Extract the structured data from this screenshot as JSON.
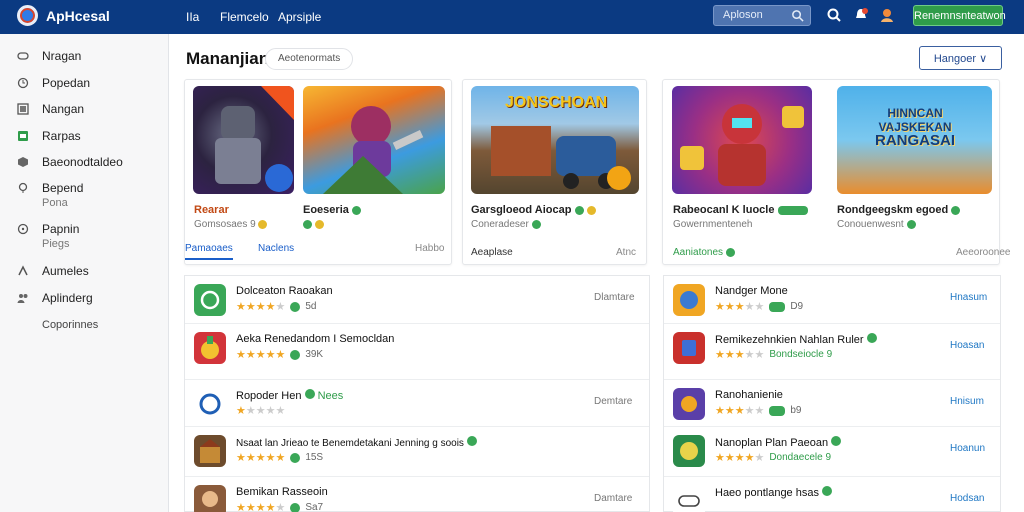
{
  "header": {
    "app_title": "ApHcesal",
    "nav": [
      "IIa",
      "Flemcelo",
      "Aprsiple"
    ],
    "search_placeholder": "Aploson",
    "cta_label": "Renemnsnteatwon"
  },
  "sidebar": {
    "items": [
      {
        "label": "Nragan",
        "icon": "gamepad-icon"
      },
      {
        "label": "Popedan",
        "icon": "clock-icon"
      },
      {
        "label": "Nangan",
        "icon": "grid-icon"
      },
      {
        "label": "Rarpas",
        "icon": "tag-icon"
      },
      {
        "label": "Baeonodtaldeo",
        "icon": "shield-icon"
      },
      {
        "label": "Bepend",
        "sub": "Pona",
        "icon": "heart-icon"
      },
      {
        "label": "Papnin",
        "sub": "Piegs",
        "icon": "info-icon"
      },
      {
        "label": "Aumeles",
        "icon": "user-icon"
      },
      {
        "label": "Aplinderg",
        "icon": "people-icon"
      }
    ],
    "footer": "Coporinnes"
  },
  "main": {
    "title": "Mananjian",
    "subtitle": "Aeotenormats",
    "dropdown_label": "Hangoer"
  },
  "featured": {
    "left_card": {
      "games": [
        {
          "title": "Rearar",
          "meta": "Gomsosaes 9"
        },
        {
          "title": "Eoeseria",
          "meta": ""
        }
      ],
      "tabs": [
        "Pamaoaes",
        "Naclens",
        "Habbo"
      ]
    },
    "middle_card": {
      "thumb_text": "JONSCHOAN",
      "title": "Garsgloeod Aiocap",
      "meta": "Coneradeser",
      "tabs": [
        "Aeaplase",
        "Atnc"
      ]
    },
    "right_card": {
      "games": [
        {
          "title": "Rabeocanl K luocle",
          "meta": "Gowernmenteneh"
        },
        {
          "title": "Rondgeegskm egoed",
          "meta": "Conouenwesnt"
        }
      ],
      "banner_lines": [
        "HINNCAN",
        "VAJSKEKAN",
        "RANGASAI"
      ],
      "tabs": [
        "Aaniatones",
        "Aeeoroonee"
      ]
    }
  },
  "left_list": [
    {
      "title": "Dolceaton Raoakan",
      "rating": "4",
      "count": "5d",
      "action": "Dlamtare",
      "icon": "leaf-app-icon"
    },
    {
      "title": "Aeka Renedandom I Semocldan",
      "rating": "4.5",
      "count": "39K",
      "action": "",
      "icon": "potion-app-icon"
    },
    {
      "title": "Ropoder Hen",
      "rating": "1",
      "count": "Nees",
      "action": "Demtare",
      "icon": "swirl-app-icon"
    },
    {
      "title": "Nsaat lan Jrieao te Benemdetakani Jenning g soois",
      "rating": "4.5",
      "count": "15S",
      "action": "",
      "icon": "castle-app-icon"
    },
    {
      "title": "Bemikan Rasseoin",
      "rating": "4",
      "count": "Sa7",
      "action": "Damtare",
      "icon": "character-app-icon"
    }
  ],
  "right_list": [
    {
      "title": "Nandger Mone",
      "rating": "3.5",
      "count": "D9",
      "action": "Hnasum",
      "icon": "hero-app-icon"
    },
    {
      "title": "Remikezehnkien Nahlan Ruler",
      "rating": "3.5",
      "count": "Bondseiocle 9",
      "action": "Hoasan",
      "icon": "cards-app-icon"
    },
    {
      "title": "Ranohanienie",
      "rating": "3",
      "count": "b9",
      "action": "Hnisum",
      "icon": "robot-app-icon"
    },
    {
      "title": "Nanoplan Plan Paeoan",
      "rating": "4",
      "count": "Dondaecele 9",
      "action": "Hoanun",
      "icon": "monster-app-icon"
    },
    {
      "title": "Haeo pontlange hsas",
      "rating": "",
      "count": "",
      "action": "Hodsan",
      "icon": "controller-app-icon"
    }
  ],
  "colors": {
    "topbar": "#0b3a82",
    "accent_blue": "#1a5ec9",
    "cta_green": "#2f9c4a",
    "star": "#f0a623"
  }
}
